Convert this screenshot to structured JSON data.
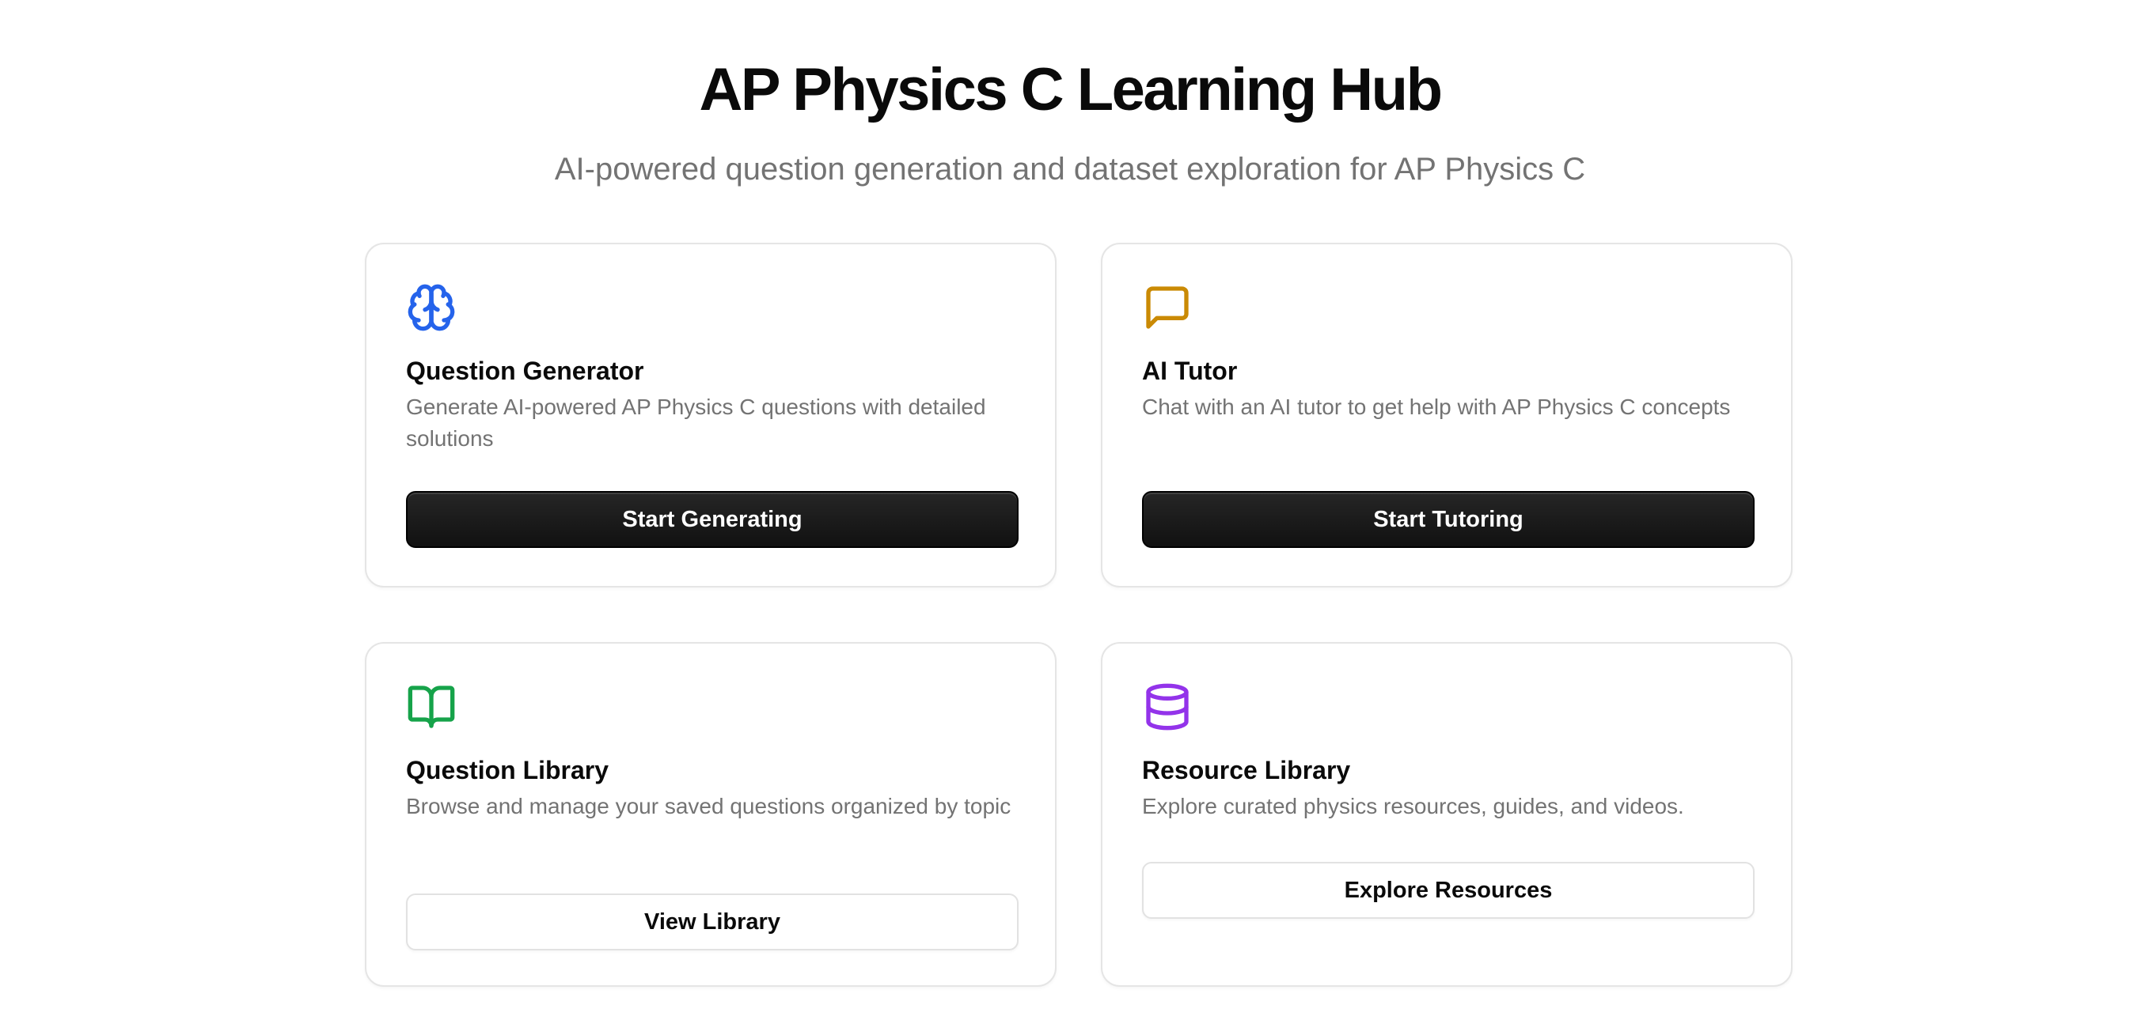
{
  "header": {
    "title": "AP Physics C Learning Hub",
    "subtitle": "AI-powered question generation and dataset exploration for AP Physics C"
  },
  "cards": [
    {
      "icon": "brain-icon",
      "icon_color": "#2563eb",
      "title": "Question Generator",
      "description": "Generate AI-powered AP Physics C questions with detailed solutions",
      "button": "Start Generating",
      "button_style": "primary"
    },
    {
      "icon": "message-square-icon",
      "icon_color": "#ca8a04",
      "title": "AI Tutor",
      "description": "Chat with an AI tutor to get help with AP Physics C concepts",
      "button": "Start Tutoring",
      "button_style": "primary"
    },
    {
      "icon": "book-open-icon",
      "icon_color": "#16a34a",
      "title": "Question Library",
      "description": "Browse and manage your saved questions organized by topic",
      "button": "View Library",
      "button_style": "outline"
    },
    {
      "icon": "database-icon",
      "icon_color": "#9333ea",
      "title": "Resource Library",
      "description": "Explore curated physics resources, guides, and videos.",
      "button": "Explore Resources",
      "button_style": "outline"
    }
  ]
}
